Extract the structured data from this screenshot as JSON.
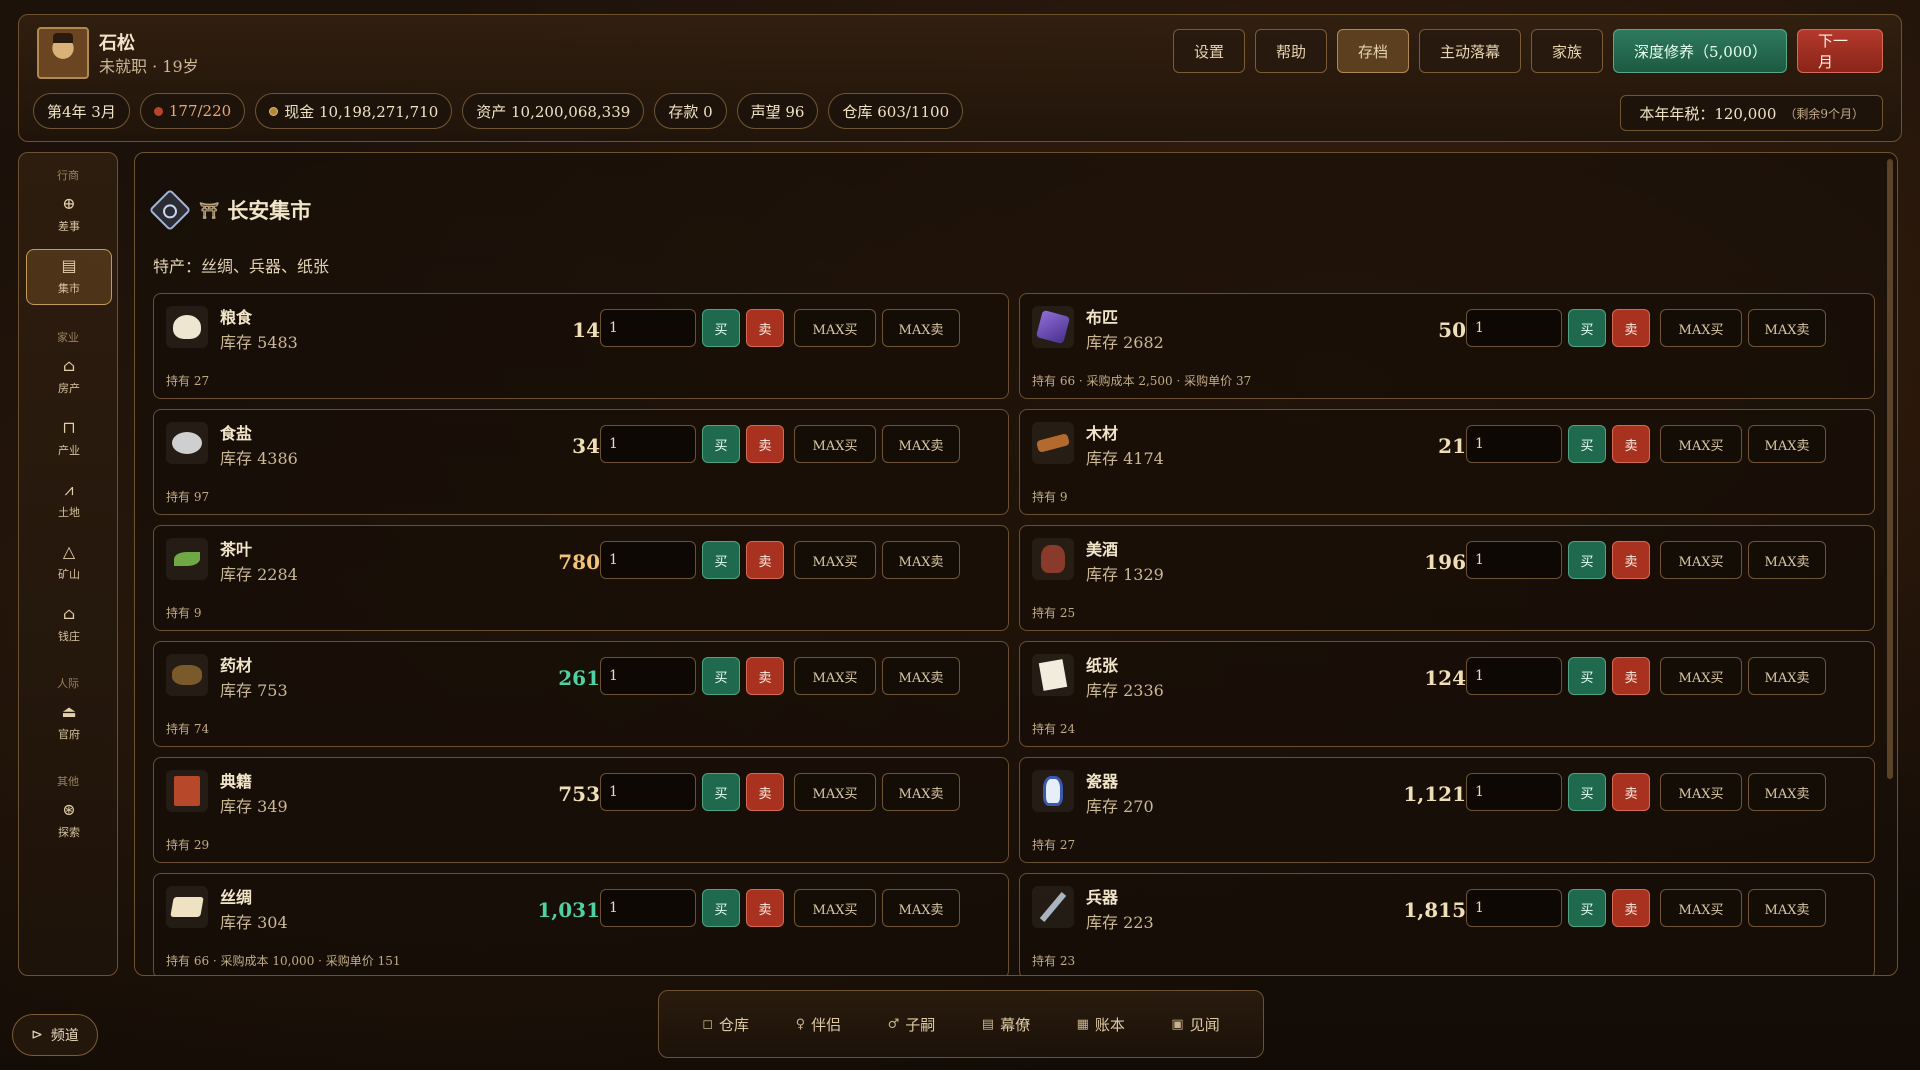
{
  "player": {
    "name": "石松",
    "subtitle": "未就职 · 19岁"
  },
  "top_buttons": [
    "设置",
    "帮助",
    "存档",
    "主动落幕",
    "家族",
    "深度修养（5,000）",
    "下一月"
  ],
  "stats": {
    "date": "第4年 3月",
    "health": "177/220",
    "cash": "现金 10,198,271,710",
    "assets": "资产 10,200,068,339",
    "deposit": "存款 0",
    "reputation": "声望 96",
    "warehouse": "仓库 603/1100"
  },
  "tax": {
    "label": "本年年税：120,000",
    "remaining": "（剩余9个月）"
  },
  "sidebar": {
    "groups": [
      "行商",
      "家业",
      "人际",
      "其他"
    ],
    "items": [
      "差事",
      "集市",
      "房产",
      "产业",
      "土地",
      "矿山",
      "钱庄",
      "官府",
      "探索"
    ]
  },
  "market": {
    "title": "长安集市",
    "specialty": "特产：丝绸、兵器、纸张",
    "buttons": {
      "buy": "买",
      "sell": "卖",
      "max_buy": "MAX买",
      "max_sell": "MAX卖"
    },
    "goods": [
      {
        "name": "粮食",
        "stock": "库存 5483",
        "price": "14",
        "qty": "1",
        "hold": "持有 27",
        "icon": "bun-icon"
      },
      {
        "name": "布匹",
        "stock": "库存 2682",
        "price": "50",
        "qty": "1",
        "hold": "持有 66 · 采购成本 2,500 · 采购单价 37",
        "icon": "cloth-icon"
      },
      {
        "name": "食盐",
        "stock": "库存 4386",
        "price": "34",
        "qty": "1",
        "hold": "持有 97",
        "icon": "salt-icon"
      },
      {
        "name": "木材",
        "stock": "库存 4174",
        "price": "21",
        "qty": "1",
        "hold": "持有 9",
        "icon": "wood-icon"
      },
      {
        "name": "茶叶",
        "stock": "库存 2284",
        "price": "780",
        "qty": "1",
        "hold": "持有 9",
        "icon": "tea-icon"
      },
      {
        "name": "美酒",
        "stock": "库存 1329",
        "price": "196",
        "qty": "1",
        "hold": "持有 25",
        "icon": "wine-jar-icon"
      },
      {
        "name": "药材",
        "stock": "库存 753",
        "price": "261",
        "qty": "1",
        "hold": "持有 74",
        "icon": "herb-icon"
      },
      {
        "name": "纸张",
        "stock": "库存 2336",
        "price": "124",
        "qty": "1",
        "hold": "持有 24",
        "icon": "paper-icon"
      },
      {
        "name": "典籍",
        "stock": "库存 349",
        "price": "753",
        "qty": "1",
        "hold": "持有 29",
        "icon": "book-icon"
      },
      {
        "name": "瓷器",
        "stock": "库存 270",
        "price": "1,121",
        "qty": "1",
        "hold": "持有 27",
        "icon": "vase-icon"
      },
      {
        "name": "丝绸",
        "stock": "库存 304",
        "price": "1,031",
        "qty": "1",
        "hold": "持有 66 · 采购成本 10,000 · 采购单价 151",
        "icon": "silk-icon"
      },
      {
        "name": "兵器",
        "stock": "库存 223",
        "price": "1,815",
        "qty": "1",
        "hold": "持有 23",
        "icon": "sword-icon"
      }
    ]
  },
  "bottom_nav": [
    "仓库",
    "伴侣",
    "子嗣",
    "幕僚",
    "账本",
    "见闻"
  ],
  "channel": "频道",
  "colors": {
    "price_up": "#4fd1a1",
    "price_mid": "#f1c27a",
    "buy": "#1f6a4f",
    "sell": "#a8321f"
  }
}
